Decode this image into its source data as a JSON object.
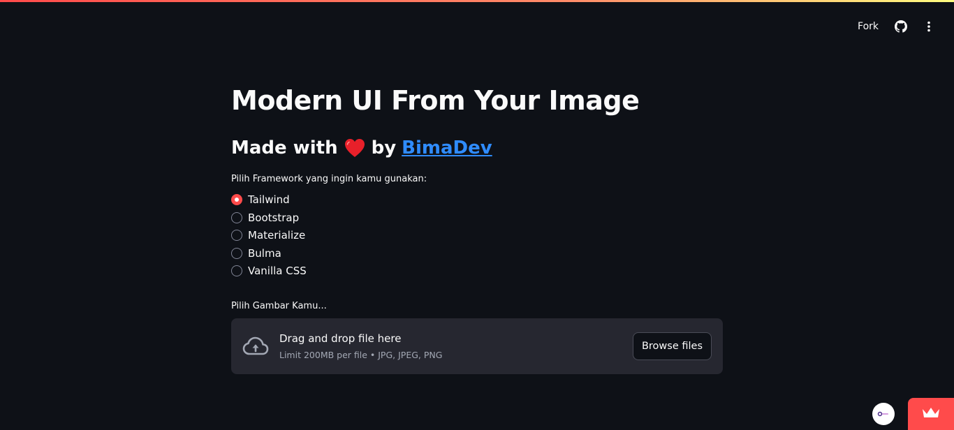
{
  "toolbar": {
    "fork_label": "Fork",
    "github_icon": "github-icon",
    "menu_icon": "kebab-menu-icon"
  },
  "main": {
    "title": "Modern UI From Your Image",
    "subtitle_prefix": "Made with",
    "subtitle_by": "by",
    "author_link": "BimaDev",
    "framework_label": "Pilih Framework yang ingin kamu gunakan:",
    "frameworks": [
      "Tailwind",
      "Bootstrap",
      "Materialize",
      "Bulma",
      "Vanilla CSS"
    ],
    "selected_framework": "Tailwind",
    "image_label": "Pilih Gambar Kamu...",
    "uploader": {
      "title": "Drag and drop file here",
      "subtitle": "Limit 200MB per file • JPG, JPEG, PNG",
      "button": "Browse files"
    }
  },
  "colors": {
    "background": "#0e1117",
    "accent": "#ff4b4b",
    "link": "#2f8cff",
    "dropzone": "#262730"
  }
}
